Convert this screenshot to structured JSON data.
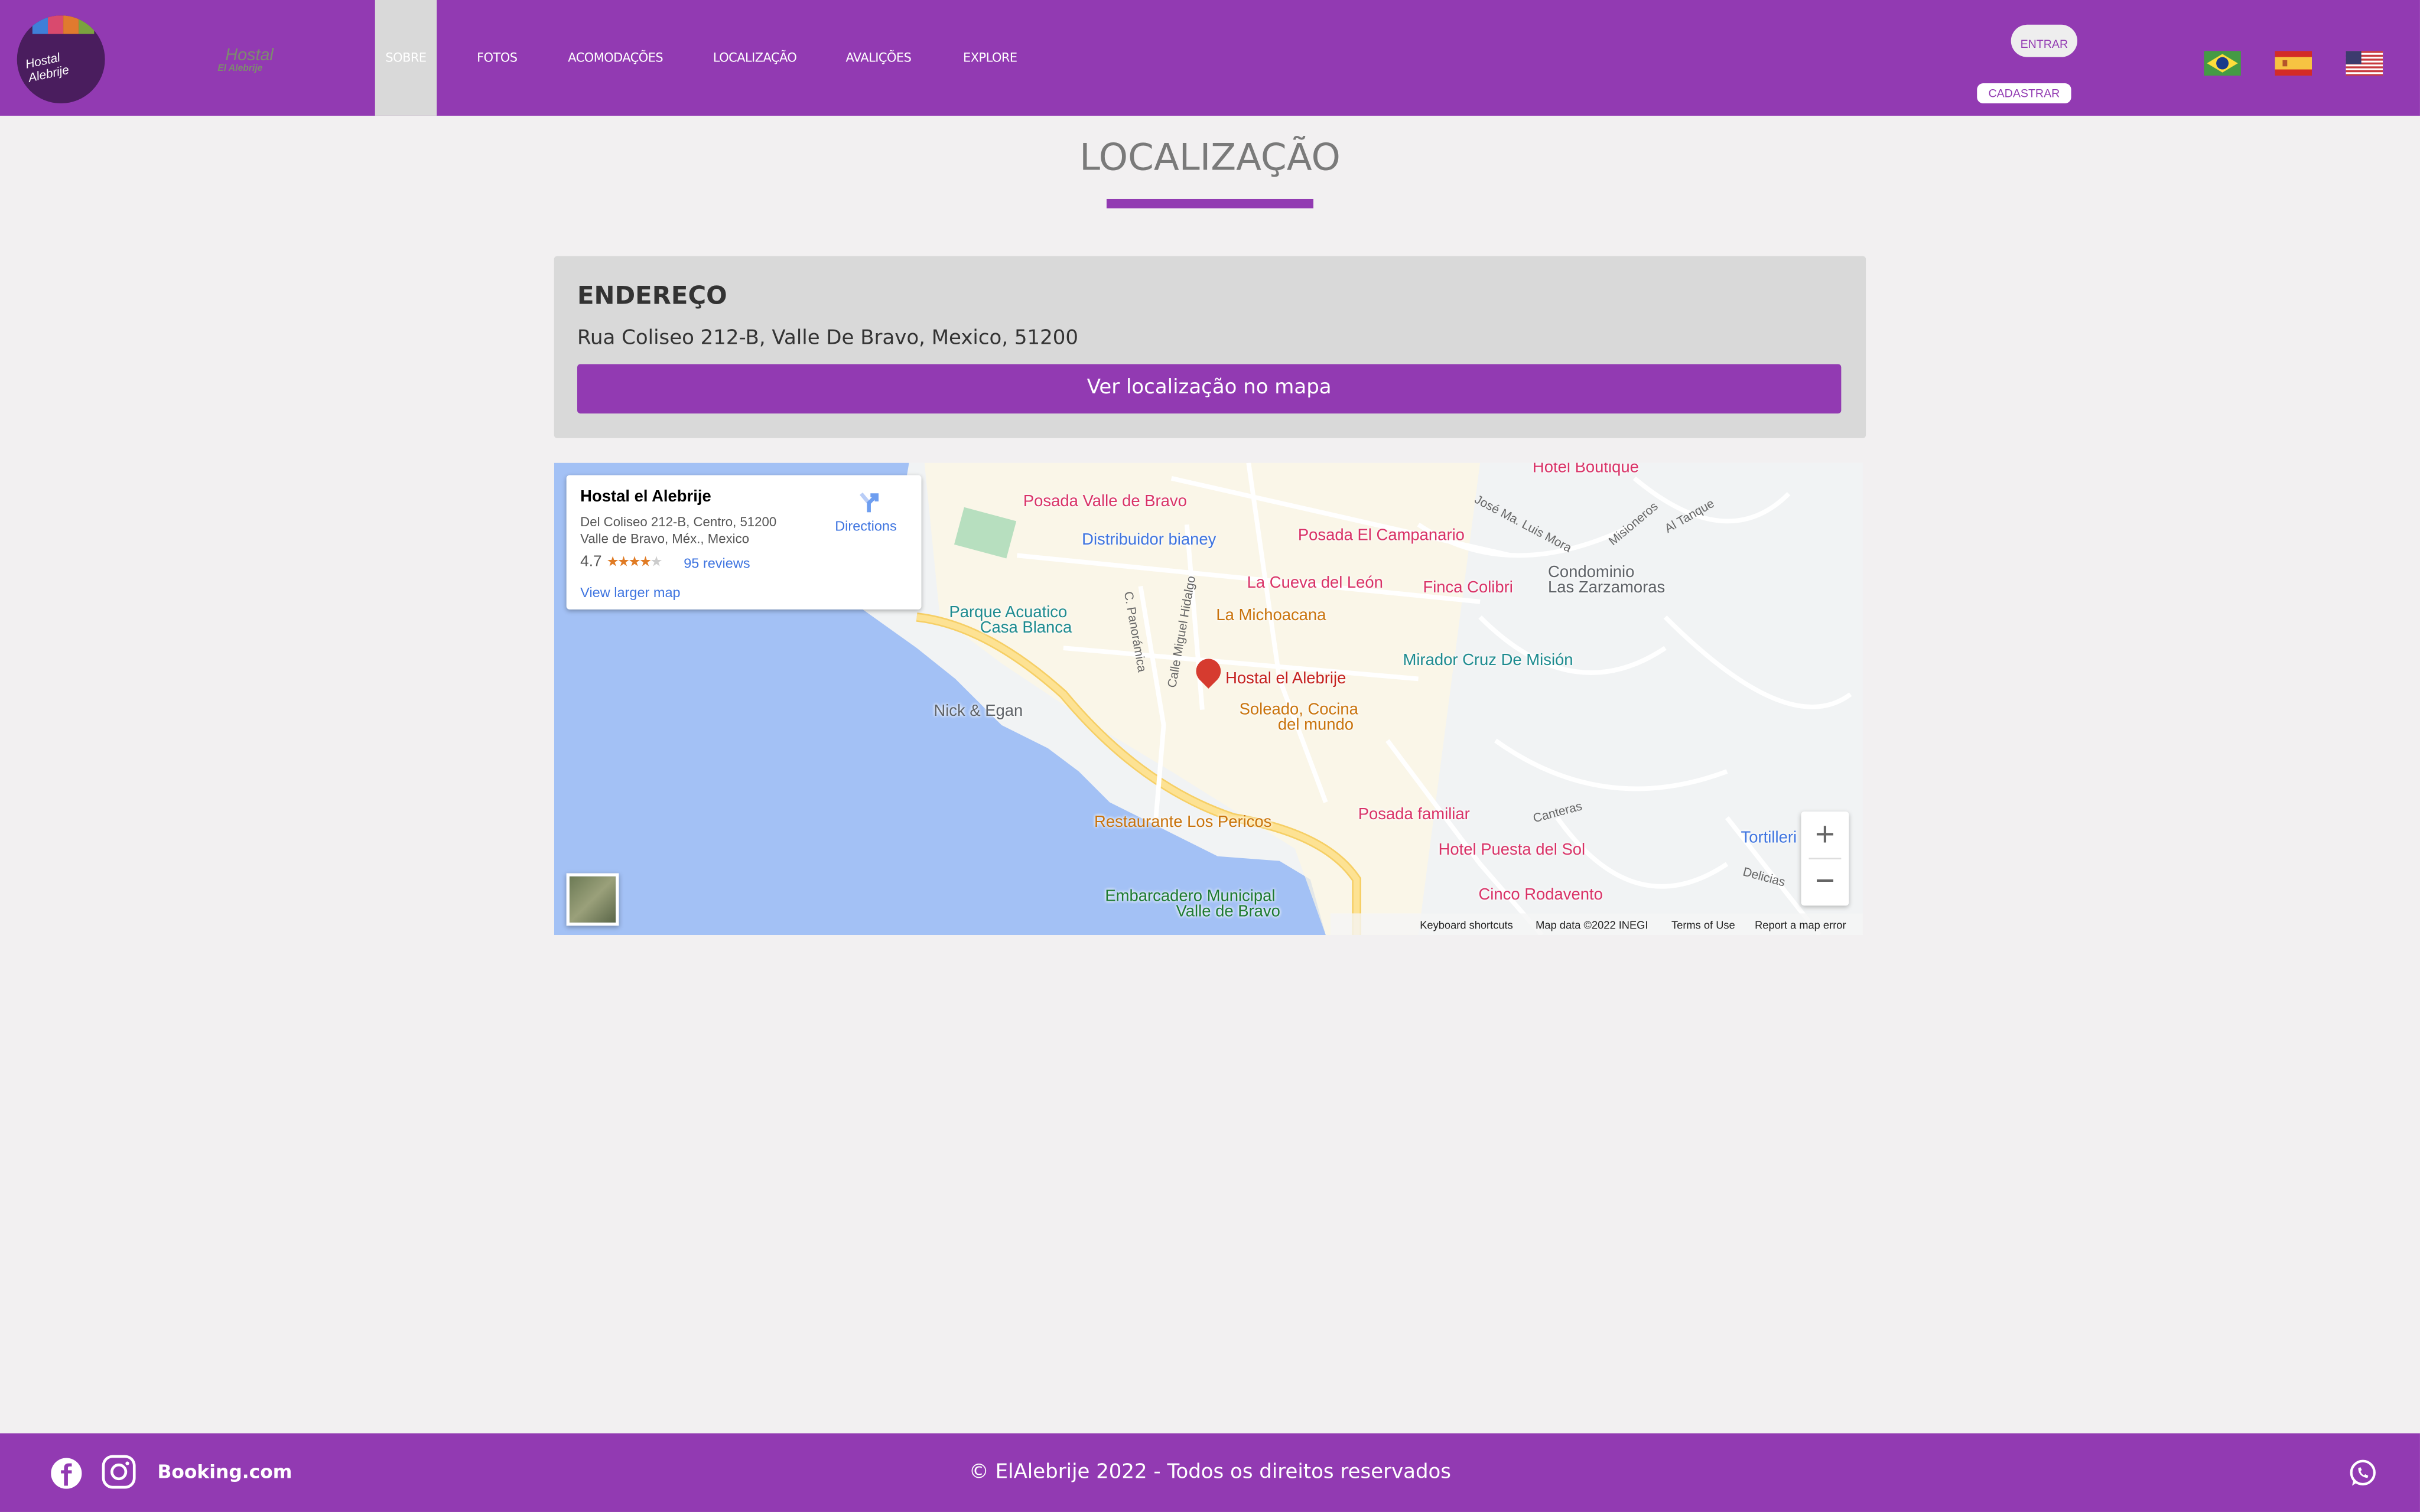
{
  "header": {
    "brand_line1": "Hostal",
    "brand_line2": "El Alebrije",
    "logo_text": "Hostal Alebrije",
    "nav": [
      {
        "label": "SOBRE",
        "active": true
      },
      {
        "label": "FOTOS"
      },
      {
        "label": "ACOMODAÇÕES"
      },
      {
        "label": "LOCALIZAÇÃO"
      },
      {
        "label": "AVALIÇÕES"
      },
      {
        "label": "EXPLORE"
      }
    ],
    "login_label": "ENTRAR",
    "signup_label": "CADASTRAR",
    "flags": [
      "brazil-flag",
      "spain-flag",
      "usa-flag"
    ]
  },
  "page_title": "LOCALIZAÇÃO",
  "address_card": {
    "heading": "ENDEREÇO",
    "address": "Rua Coliseo 212-B, Valle De Bravo, Mexico, 51200",
    "button": "Ver localização no mapa"
  },
  "map": {
    "info": {
      "name": "Hostal el Alebrije",
      "address_line1": "Del Coliseo 212-B, Centro, 51200",
      "address_line2": "Valle de Bravo, Méx., Mexico",
      "rating": "4.7",
      "stars": 4.7,
      "reviews": "95 reviews",
      "directions": "Directions",
      "larger_map": "View larger map"
    },
    "places": {
      "main": "Hostal el Alebrije",
      "p1": "Posada Valle de Bravo",
      "p2": "Posada El Campanario",
      "p3": "La Cueva del León",
      "p4": "Finca Colibri",
      "p5": "Hotel Boutique",
      "p6": "Posada familiar",
      "p7": "Hotel Puesta del Sol",
      "p8": "Cinco Rodavento",
      "b1": "Distribuidor bianey",
      "b2": "Tortilleri",
      "o1": "La Michoacana",
      "o2a": "Soleado, Cocina",
      "o2b": "del mundo",
      "o3": "Restaurante Los Pericos",
      "t1a": "Parque Acuatico",
      "t1b": "Casa Blanca",
      "t2": "Mirador Cruz De Misión",
      "g1a": "Embarcadero Municipal",
      "g1b": "Valle de Bravo",
      "n1": "Nick & Egan",
      "c1a": "Condominio",
      "c1b": "Las Zarzamoras"
    },
    "streets": {
      "s1": "José Ma. Luis Mora",
      "s2": "Misioneros",
      "s3": "Al Tanque",
      "s4": "C. Panorámica",
      "s5": "Calle Miguel Hidalgo",
      "s6": "Canteras",
      "s7": "Delicias"
    },
    "attribution": {
      "keyboard": "Keyboard shortcuts",
      "data": "Map data ©2022 INEGI",
      "terms": "Terms of Use",
      "report": "Report a map error"
    },
    "colors": {
      "water": "#a3c1f5",
      "land": "#f1f3f4",
      "road": "#fde293"
    }
  },
  "footer": {
    "booking": "Booking.com",
    "copyright": "© ElAlebrije 2022 - Todos os direitos reservados"
  },
  "colors": {
    "brand": "#923ab2",
    "background": "#f2f0f1"
  }
}
